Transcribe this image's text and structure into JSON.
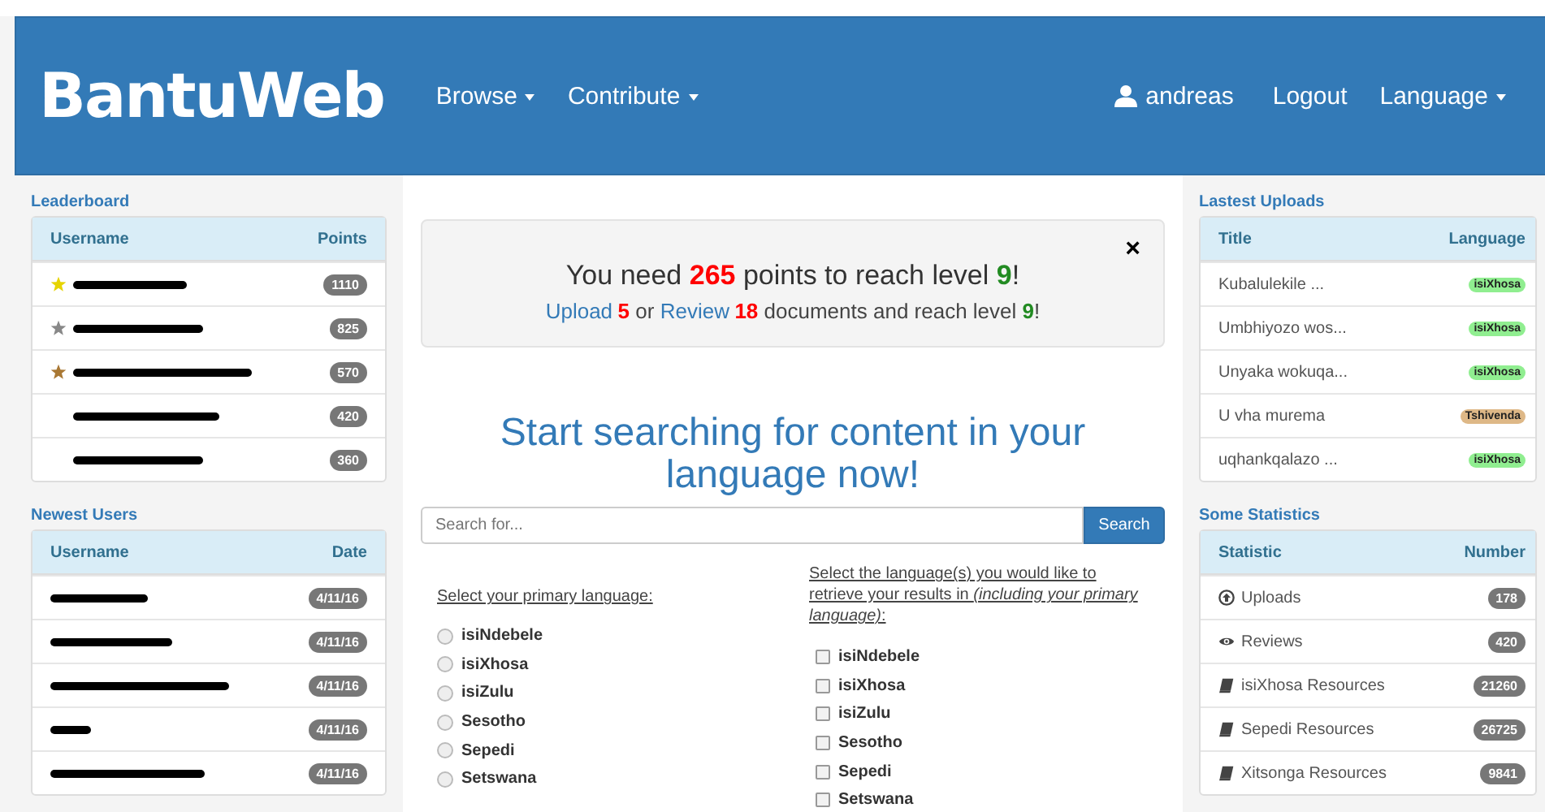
{
  "navbar": {
    "brand": "BantuWeb",
    "left_menu": [
      {
        "label": "Browse",
        "dropdown": true
      },
      {
        "label": "Contribute",
        "dropdown": true
      }
    ],
    "user": "andreas",
    "right_menu": [
      {
        "label": "Logout",
        "dropdown": false
      },
      {
        "label": "Language",
        "dropdown": true
      }
    ]
  },
  "leaderboard": {
    "title": "Leaderboard",
    "columns": [
      "Username",
      "Points"
    ],
    "rows": [
      {
        "color": "#e6d400",
        "points": "1110"
      },
      {
        "color": "#888888",
        "points": "825"
      },
      {
        "color": "#a97834",
        "points": "570"
      },
      {
        "points": "420"
      },
      {
        "points": "360"
      }
    ]
  },
  "newest_users": {
    "title": "Newest Users",
    "columns": [
      "Username",
      "Date"
    ],
    "rows": [
      {
        "date": "4/11/16"
      },
      {
        "date": "4/11/16"
      },
      {
        "date": "4/11/16"
      },
      {
        "date": "4/11/16"
      },
      {
        "date": "4/11/16"
      }
    ]
  },
  "alert": {
    "close": "×",
    "line1": [
      {
        "kind": "text",
        "text": "You need "
      },
      {
        "kind": "count",
        "text": "265"
      },
      {
        "kind": "text",
        "text": " points to reach level "
      },
      {
        "kind": "level",
        "text": "9"
      },
      {
        "kind": "text",
        "text": "!"
      }
    ],
    "line2": [
      {
        "kind": "link",
        "text": "Upload"
      },
      {
        "kind": "count",
        "text": "5"
      },
      {
        "kind": "text",
        "text": " or "
      },
      {
        "kind": "link",
        "text": "Review"
      },
      {
        "kind": "count",
        "text": "18"
      },
      {
        "kind": "text",
        "text": " documents and reach level "
      },
      {
        "kind": "level",
        "text": "9"
      },
      {
        "kind": "text",
        "text": "!"
      }
    ]
  },
  "search": {
    "heading": "Start searching for content in your language now!",
    "placeholder": "Search for...",
    "button": "Search"
  },
  "primary_language": {
    "label": "Select your primary language:",
    "options": [
      {
        "label": "isiNdebele",
        "selected": false
      },
      {
        "label": "isiXhosa",
        "selected": false
      },
      {
        "label": "isiZulu",
        "selected": false
      },
      {
        "label": "Sesotho",
        "selected": false
      },
      {
        "label": "Sepedi",
        "selected": false
      },
      {
        "label": "Setswana",
        "selected": false
      }
    ]
  },
  "result_languages": {
    "label": "Select the language(s) you would like to retrieve your results in *(including your primary language)*:",
    "options": [
      {
        "label": "isiNdebele",
        "checked": false
      },
      {
        "label": "isiXhosa",
        "checked": false
      },
      {
        "label": "isiZulu",
        "checked": false
      },
      {
        "label": "Sesotho",
        "checked": false
      },
      {
        "label": "Sepedi",
        "checked": false
      },
      {
        "label": "Setswana",
        "checked": false
      }
    ]
  },
  "latest_uploads": {
    "title": "Lastest Uploads",
    "columns": [
      "Title",
      "Language"
    ],
    "rows": [
      {
        "title": "Kubalulekile ...",
        "language": "isiXhosa",
        "color": "#90ee90"
      },
      {
        "title": "Umbhiyozo wos...",
        "language": "isiXhosa",
        "color": "#90ee90"
      },
      {
        "title": "Unyaka wokuqa...",
        "language": "isiXhosa",
        "color": "#90ee90"
      },
      {
        "title": "U vha murema",
        "language": "Tshivenda",
        "color": "#deb887"
      },
      {
        "title": "uqhankqalazo ...",
        "language": "isiXhosa",
        "color": "#90ee90"
      }
    ]
  },
  "statistics": {
    "title": "Some Statistics",
    "columns": [
      "Statistic",
      "Number"
    ],
    "rows": [
      {
        "kind": "upload",
        "label": "Uploads",
        "value": "178"
      },
      {
        "kind": "review",
        "label": "Reviews",
        "value": "420"
      },
      {
        "kind": "resource",
        "label": "isiXhosa Resources",
        "value": "21260"
      },
      {
        "kind": "resource",
        "label": "Sepedi Resources",
        "value": "26725"
      },
      {
        "kind": "resource",
        "label": "Xitsonga Resources",
        "value": "9841"
      }
    ]
  }
}
